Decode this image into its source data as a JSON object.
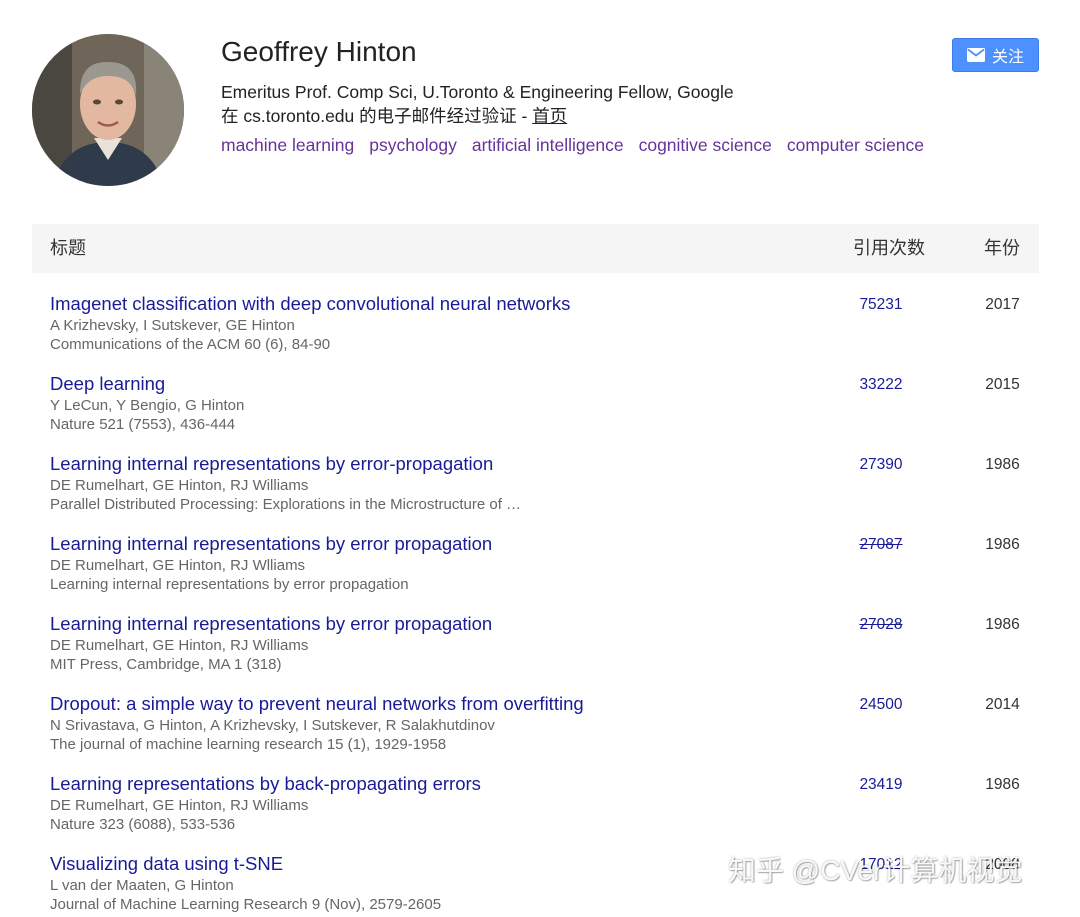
{
  "profile": {
    "name": "Geoffrey Hinton",
    "affiliation": "Emeritus Prof. Comp Sci, U.Toronto & Engineering Fellow, Google",
    "verified_text": "在 cs.toronto.edu 的电子邮件经过验证 - ",
    "homepage_label": "首页",
    "interests": [
      "machine learning",
      "psychology",
      "artificial intelligence",
      "cognitive science",
      "computer science"
    ]
  },
  "follow_button": {
    "label": "关注"
  },
  "table": {
    "headers": {
      "title": "标题",
      "cited_by": "引用次数",
      "year": "年份"
    },
    "rows": [
      {
        "title": "Imagenet classification with deep convolutional neural networks",
        "authors": "A Krizhevsky, I Sutskever, GE Hinton",
        "venue": "Communications of the ACM 60 (6), 84-90",
        "cites": "75231",
        "year": "2017",
        "strike": false
      },
      {
        "title": "Deep learning",
        "authors": "Y LeCun, Y Bengio, G Hinton",
        "venue": "Nature 521 (7553), 436-444",
        "cites": "33222",
        "year": "2015",
        "strike": false
      },
      {
        "title": "Learning internal representations by error-propagation",
        "authors": "DE Rumelhart, GE Hinton, RJ Williams",
        "venue": "Parallel Distributed Processing: Explorations in the Microstructure of …",
        "cites": "27390",
        "year": "1986",
        "strike": false
      },
      {
        "title": "Learning internal representations by error propagation",
        "authors": "DE Rumelhart, GE Hinton, RJ Wlliams",
        "venue": "Learning internal representations by error propagation",
        "cites": "27087",
        "year": "1986",
        "strike": true
      },
      {
        "title": "Learning internal representations by error propagation",
        "authors": "DE Rumelhart, GE Hinton, RJ Williams",
        "venue": "MIT Press, Cambridge, MA 1 (318)",
        "cites": "27028",
        "year": "1986",
        "strike": true
      },
      {
        "title": "Dropout: a simple way to prevent neural networks from overfitting",
        "authors": "N Srivastava, G Hinton, A Krizhevsky, I Sutskever, R Salakhutdinov",
        "venue": "The journal of machine learning research 15 (1), 1929-1958",
        "cites": "24500",
        "year": "2014",
        "strike": false
      },
      {
        "title": "Learning representations by back-propagating errors",
        "authors": "DE Rumelhart, GE Hinton, RJ Williams",
        "venue": "Nature 323 (6088), 533-536",
        "cites": "23419",
        "year": "1986",
        "strike": false
      },
      {
        "title": "Visualizing data using t-SNE",
        "authors": "L van der Maaten, G Hinton",
        "venue": "Journal of Machine Learning Research 9 (Nov), 2579-2605",
        "cites": "17012",
        "year": "2008",
        "strike": false
      }
    ]
  },
  "watermark": "知乎 @CVer计算机视觉",
  "colors": {
    "link": "#1a1a99",
    "interest": "#663399",
    "button": "#4d90fe",
    "header_bg": "#f5f5f5"
  }
}
